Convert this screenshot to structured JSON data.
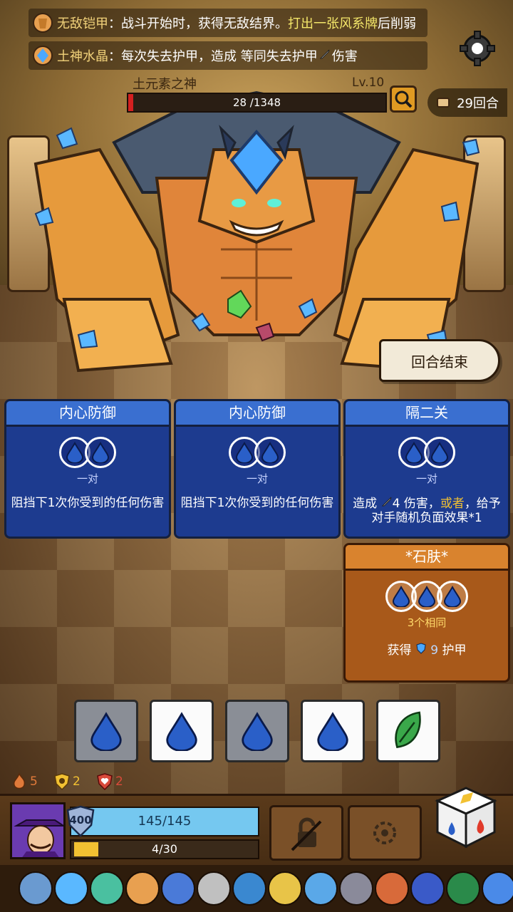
{
  "status_effects": [
    {
      "name": "无敌铠甲",
      "sep": "：",
      "text": "战斗开始时，获得无敌结界。",
      "highlight": "打出一张风系牌",
      "suffix": "后削弱"
    },
    {
      "name": "土神水晶",
      "sep": "：",
      "text": "每次失去护甲，造成 等同失去护甲",
      "suffix": "伤害"
    }
  ],
  "boss": {
    "name": "土元素之神",
    "level": "Lv.10",
    "hp_text": "28 /1348",
    "hp_fraction": 0.02
  },
  "turn": {
    "text": "29回合"
  },
  "end_turn": {
    "label": "回合结束"
  },
  "cards": [
    {
      "title": "内心防御",
      "requirement": "一对",
      "description": "阻挡下1次你受到的任何伤害"
    },
    {
      "title": "内心防御",
      "requirement": "一对",
      "description": "阻挡下1次你受到的任何伤害"
    },
    {
      "title": "隔二关",
      "requirement": "一对",
      "description_a": "造成",
      "description_b": "4 伤害，",
      "description_or": "或者",
      "description_c": "，给予对手随机负面效果*1"
    }
  ],
  "special_card": {
    "title": "*石肤*",
    "requirement": "3个相同",
    "desc_a": "获得",
    "desc_value": "9",
    "desc_b": "护甲"
  },
  "dice": [
    {
      "element": "water",
      "state": "used"
    },
    {
      "element": "water",
      "state": "free"
    },
    {
      "element": "water",
      "state": "used"
    },
    {
      "element": "water",
      "state": "free"
    },
    {
      "element": "wind",
      "state": "free"
    }
  ],
  "mini_stats": [
    {
      "icon": "fire-icon",
      "value": "5",
      "color": "#e07a3a"
    },
    {
      "icon": "shield-icon",
      "value": "2",
      "color": "#f2c132"
    },
    {
      "icon": "heart-shield-icon",
      "value": "2",
      "color": "#d84a3a"
    }
  ],
  "player": {
    "armor": "400",
    "hp_text": "145/145",
    "xp_text": "4/30"
  },
  "colors": {
    "water": "#2a5fc8",
    "wind": "#3aa84a",
    "hp": "#d42020",
    "card_blue": "#1d3b8f",
    "card_orange": "#a8591a"
  }
}
